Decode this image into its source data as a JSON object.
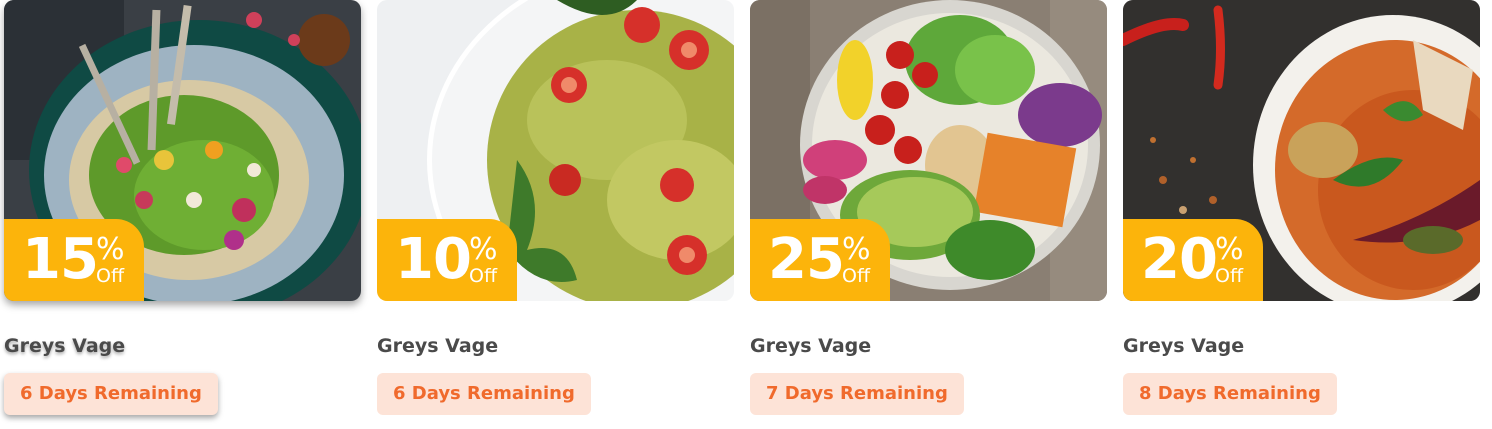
{
  "deals": [
    {
      "discount": "15",
      "percent": "%",
      "off": "Off",
      "title": "Greys Vage",
      "remaining": "6 Days Remaining",
      "image": "salad-bowl-pomegranate-image"
    },
    {
      "discount": "10",
      "percent": "%",
      "off": "Off",
      "title": "Greys Vage",
      "remaining": "6 Days Remaining",
      "image": "pesto-farfalle-pasta-image"
    },
    {
      "discount": "25",
      "percent": "%",
      "off": "Off",
      "title": "Greys Vage",
      "remaining": "7 Days Remaining",
      "image": "buddha-bowl-avocado-image"
    },
    {
      "discount": "20",
      "percent": "%",
      "off": "Off",
      "title": "Greys Vage",
      "remaining": "8 Days Remaining",
      "image": "red-curry-bowl-image"
    }
  ],
  "colors": {
    "badge": "#fcb40b",
    "pill_bg": "#fde3d7",
    "pill_text": "#f06a2c",
    "title_text": "#4a4a4a"
  }
}
